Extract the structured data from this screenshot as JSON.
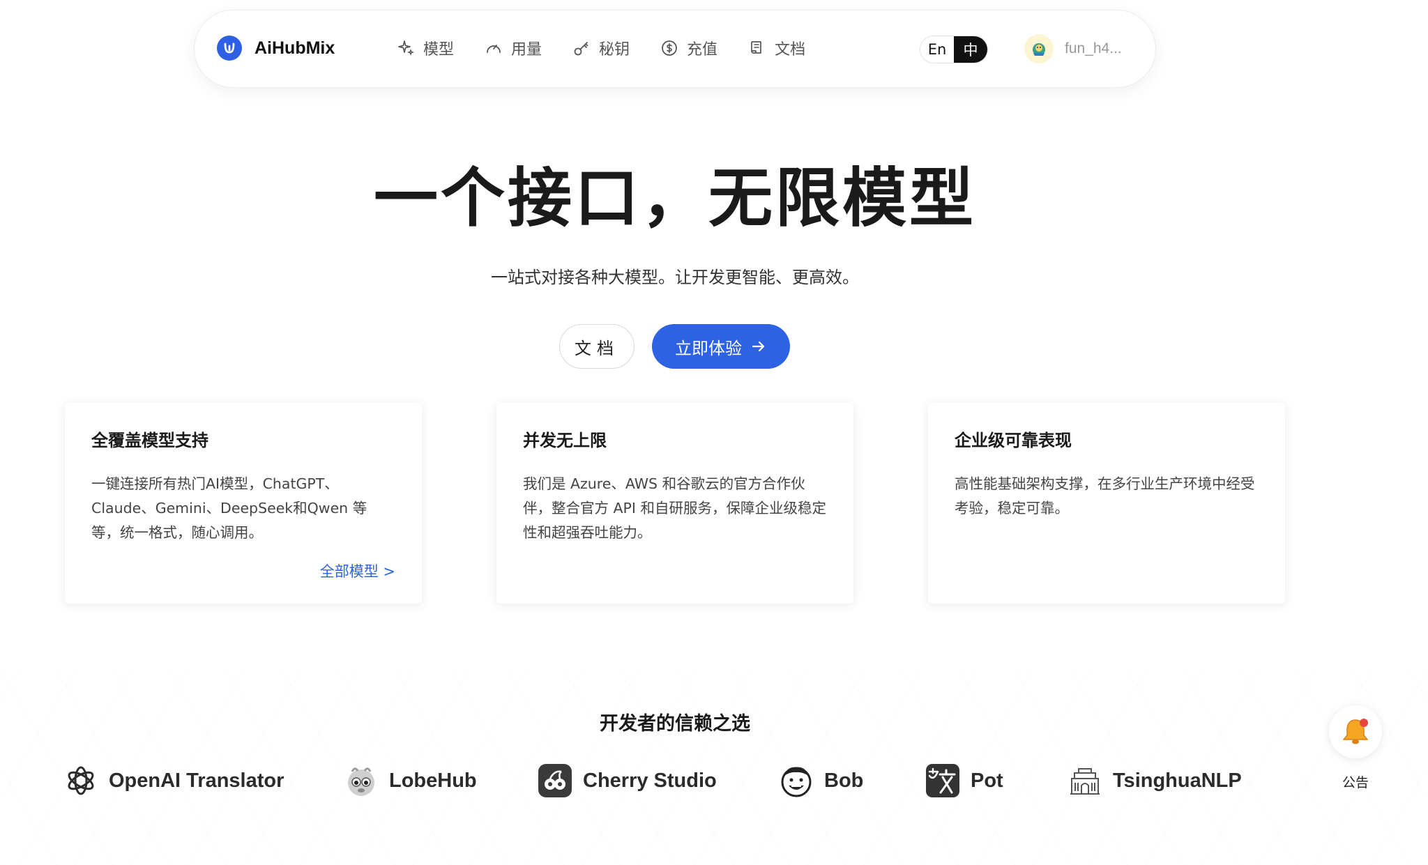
{
  "nav": {
    "brand": "AiHubMix",
    "links": [
      {
        "label": "模型",
        "icon": "sparkle-icon"
      },
      {
        "label": "用量",
        "icon": "gauge-icon"
      },
      {
        "label": "秘钥",
        "icon": "key-icon"
      },
      {
        "label": "充值",
        "icon": "dollar-icon"
      },
      {
        "label": "文档",
        "icon": "document-icon"
      }
    ],
    "lang": {
      "en": "En",
      "zh": "中",
      "active": "zh"
    },
    "username": "fun_h4..."
  },
  "hero": {
    "title": "一个接口，无限模型",
    "subtitle": "一站式对接各种大模型。让开发更智能、更高效。",
    "docs_button": "文档",
    "try_button": "立即体验"
  },
  "cards": [
    {
      "title": "全覆盖模型支持",
      "body": "一键连接所有热门AI模型，ChatGPT、Claude、Gemini、DeepSeek和Qwen 等等，统一格式，随心调用。",
      "link": "全部模型 >"
    },
    {
      "title": "并发无上限",
      "body": "我们是 Azure、AWS 和谷歌云的官方合作伙伴，整合官方 API 和自研服务，保障企业级稳定性和超强吞吐能力。"
    },
    {
      "title": "企业级可靠表现",
      "body": "高性能基础架构支撑，在多行业生产环境中经受考验，稳定可靠。"
    }
  ],
  "trusted": {
    "title": "开发者的信赖之选",
    "logos": [
      {
        "name": "OpenAI Translator",
        "icon": "openai-icon"
      },
      {
        "name": "LobeHub",
        "icon": "lobehub-icon"
      },
      {
        "name": "Cherry Studio",
        "icon": "cherry-studio-icon"
      },
      {
        "name": "Bob",
        "icon": "bob-icon"
      },
      {
        "name": "Pot",
        "icon": "pot-icon"
      },
      {
        "name": "TsinghuaNLP",
        "icon": "tsinghua-icon"
      }
    ]
  },
  "notice": {
    "label": "公告",
    "icon": "bell-icon"
  },
  "colors": {
    "accent": "#2e62e5",
    "text": "#1a1a1a",
    "muted": "#555555"
  }
}
